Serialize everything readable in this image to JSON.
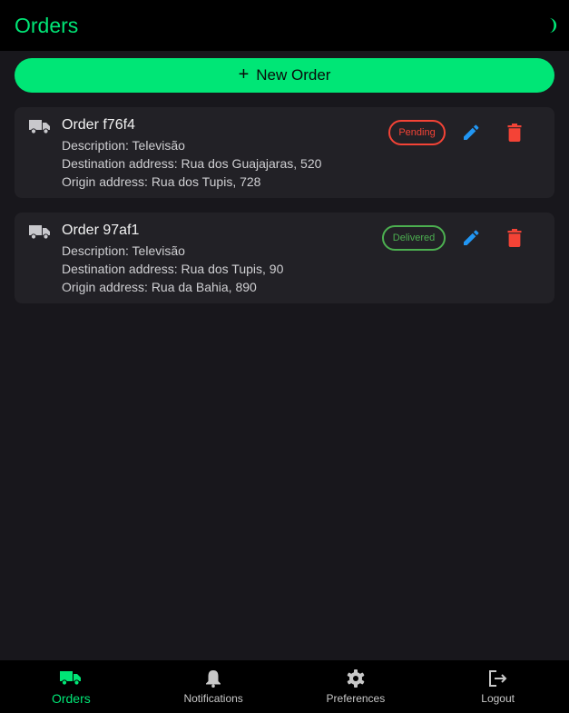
{
  "appbar": {
    "title": "Orders",
    "theme_icon": "half-moon-icon"
  },
  "new_order_button": {
    "icon": "plus-icon",
    "label": "New Order"
  },
  "orders": [
    {
      "title": "Order f76f4",
      "description": "Description: Televisão",
      "destination": "Destination address: Rua dos Guajajaras, 520",
      "origin": "Origin address: Rua dos Tupis, 728",
      "status": "Pending",
      "status_color": "#f44336"
    },
    {
      "title": "Order 97af1",
      "description": "Description: Televisão",
      "destination": "Destination address: Rua dos Tupis, 90",
      "origin": "Origin address: Rua da Bahia, 890",
      "status": "Delivered",
      "status_color": "#4caf50"
    }
  ],
  "bottom_nav": {
    "items": [
      {
        "label": "Orders",
        "icon": "truck-icon",
        "active": true
      },
      {
        "label": "Notifications",
        "icon": "bell-icon",
        "active": false
      },
      {
        "label": "Preferences",
        "icon": "gear-icon",
        "active": false
      },
      {
        "label": "Logout",
        "icon": "logout-icon",
        "active": false
      }
    ]
  },
  "colors": {
    "accent": "#00e676",
    "edit": "#2196f3",
    "delete": "#f44336",
    "background": "#18171c",
    "card": "#222126"
  }
}
